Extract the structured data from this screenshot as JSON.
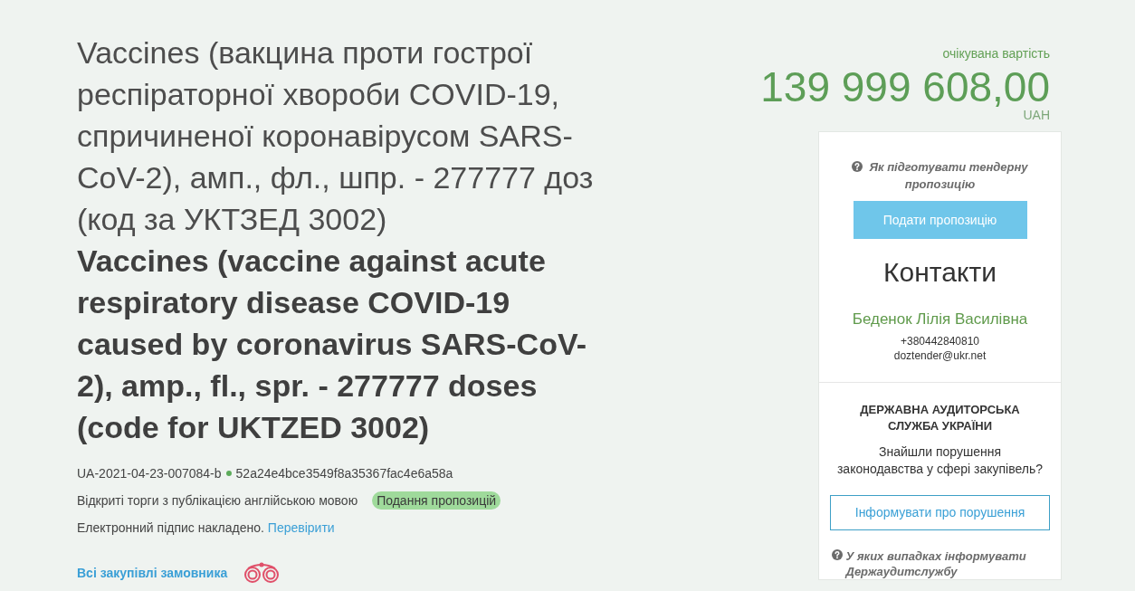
{
  "title": {
    "uk": "Vaccines (вакцина проти гострої респіраторної хвороби COVID-19, спричиненої коронавірусом SARS-CoV-2), амп., фл., шпр. - 277777 доз (код за УКТЗЕД 3002)",
    "en": "Vaccines (vaccine against acute respiratory disease COVID-19 caused by coronavirus SARS-CoV-2), amp., fl., spr. - 277777 doses (code for UKTZED 3002)"
  },
  "identifiers": {
    "tender_id": "UA-2021-04-23-007084-b",
    "hash": "52a24e4bce3549f8a35367fac4e6a58a"
  },
  "procedure": {
    "type": "Відкриті торги з публікацією англійською мовою",
    "status_badge": "Подання пропозицій"
  },
  "signature": {
    "text": "Електронний підпис накладено.",
    "link": "Перевірити"
  },
  "customer_link": "Всі закупівлі замовника",
  "price": {
    "label": "очікувана вартість",
    "amount": "139 999 608,00",
    "currency": "UAH"
  },
  "sidebar": {
    "help_link": "Як підготувати тендерну пропозицію",
    "submit_button": "Подати пропозицію",
    "contacts": {
      "heading": "Контакти",
      "name": "Беденок Лілія Василівна",
      "phone": "+380442840810",
      "email": "doztender@ukr.net"
    },
    "audit": {
      "heading": "ДЕРЖАВНА АУДИТОРСЬКА СЛУЖБА УКРАЇНИ",
      "question": "Знайшли порушення\nзаконодавства у сфері закупівель?",
      "report_button": "Інформувати про порушення",
      "help_link": "У яких випадках інформувати Держаудитслужбу"
    }
  }
}
